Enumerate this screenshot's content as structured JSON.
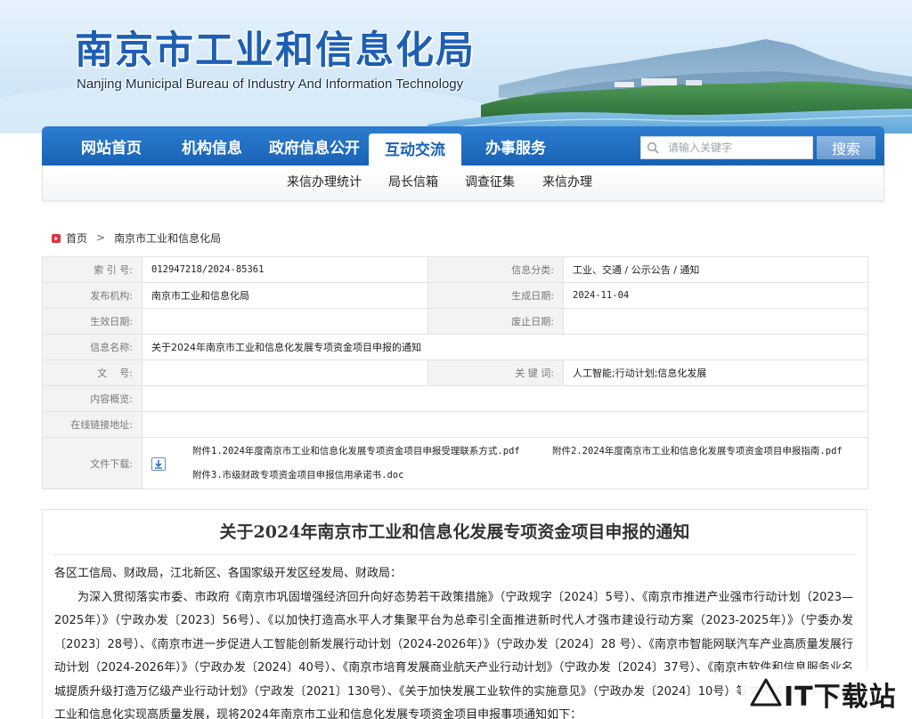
{
  "header": {
    "title": "南京市工业和信息化局",
    "subtitle": "Nanjing Municipal Bureau of Industry And Information Technology"
  },
  "nav": {
    "items": [
      {
        "label": "网站首页"
      },
      {
        "label": "机构信息"
      },
      {
        "label": "政府信息公开"
      },
      {
        "label": "互动交流",
        "active": true
      },
      {
        "label": "办事服务"
      }
    ],
    "search_placeholder": "请输入关键字",
    "search_button": "搜索"
  },
  "subnav": {
    "items": [
      {
        "label": "来信办理统计"
      },
      {
        "label": "局长信箱"
      },
      {
        "label": "调查征集"
      },
      {
        "label": "来信办理"
      }
    ]
  },
  "breadcrumb": {
    "home": "首页",
    "separator": ">",
    "current": "南京市工业和信息化局"
  },
  "info": {
    "index_no": {
      "label": "索 引 号:",
      "value": "012947218/2024-85361"
    },
    "category": {
      "label": "信息分类:",
      "value": "工业、交通 / 公示公告 / 通知"
    },
    "publisher": {
      "label": "发布机构:",
      "value": "南京市工业和信息化局"
    },
    "created_date": {
      "label": "生成日期:",
      "value": "2024-11-04"
    },
    "effective_date": {
      "label": "生效日期:",
      "value": ""
    },
    "expire_date": {
      "label": "废止日期:",
      "value": ""
    },
    "info_name": {
      "label": "信息名称:",
      "value": "关于2024年南京市工业和信息化发展专项资金项目申报的通知"
    },
    "doc_no": {
      "label": "文    号:",
      "value": ""
    },
    "keywords": {
      "label": "关 键 词:",
      "value": "人工智能;行动计划;信息化发展"
    },
    "summary": {
      "label": "内容概览:",
      "value": ""
    },
    "online_link": {
      "label": "在线链接地址:",
      "value": ""
    },
    "files": {
      "label": "文件下载:",
      "items": [
        "附件1.2024年度南京市工业和信息化发展专项资金项目申报受理联系方式.pdf",
        "附件2.2024年度南京市工业和信息化发展专项资金项目申报指南.pdf",
        "附件3.市级财政专项资金项目申报信用承诺书.doc"
      ]
    }
  },
  "article": {
    "title": "关于2024年南京市工业和信息化发展专项资金项目申报的通知",
    "salutation": "各区工信局、财政局，江北新区、各国家级开发区经发局、财政局：",
    "paragraph": "为深入贯彻落实市委、市政府《南京市巩固增强经济回升向好态势若干政策措施》（宁政规字〔2024〕5号）、《南京市推进产业强市行动计划（2023—2025年）》（宁政办发〔2023〕56号）、《以加快打造高水平人才集聚平台为总牵引全面推进新时代人才强市建设行动方案（2023-2025年）》（宁委办发〔2023〕28号）、《南京市进一步促进人工智能创新发展行动计划（2024-2026年）》（宁政办发〔2024〕28 号）、《南京市智能网联汽车产业高质量发展行动计划（2024-2026年）》（宁政办发〔2024〕40号）、《南京市培育发展商业航天产业行动计划》（宁政办发〔2024〕37号）、《南京市软件和信息服务业名城提质升级打造万亿级产业行动计划》（宁政发〔2021〕130号）、《关于加快发展工业软件的实施意见》（宁政办发〔2024〕10号）等文件精神，推动全市工业和信息化实现高质量发展，现将2024年南京市工业和信息化发展专项资金项目申报事项通知如下："
  },
  "watermark": {
    "text": "IT下载站"
  },
  "colors": {
    "nav_blue": "#1862b5",
    "title_blue": "#1d5fb3",
    "home_icon_red": "#d9363e"
  }
}
